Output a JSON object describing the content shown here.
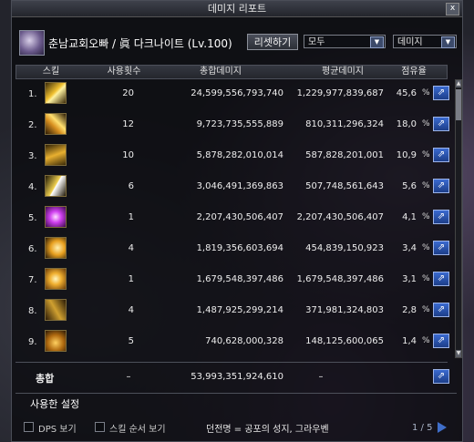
{
  "window": {
    "title": "데미지 리포트",
    "close_label": "x"
  },
  "header": {
    "character_name": "춘남교회오빠 / 眞 다크나이트 (Lv.100)",
    "reset_button": "리셋하기",
    "filter_select": "모두",
    "metric_select": "데미지"
  },
  "table": {
    "columns": [
      "스킬",
      "사용횟수",
      "총합데미지",
      "평균데미지",
      "점유율"
    ],
    "percent_symbol": "%",
    "rows": [
      {
        "rank": "1.",
        "uses": "20",
        "total": "24,599,556,793,740",
        "avg": "1,229,977,839,687",
        "share": "45,6"
      },
      {
        "rank": "2.",
        "uses": "12",
        "total": "9,723,735,555,889",
        "avg": "810,311,296,324",
        "share": "18,0"
      },
      {
        "rank": "3.",
        "uses": "10",
        "total": "5,878,282,010,014",
        "avg": "587,828,201,001",
        "share": "10,9"
      },
      {
        "rank": "4.",
        "uses": "6",
        "total": "3,046,491,369,863",
        "avg": "507,748,561,643",
        "share": "5,6"
      },
      {
        "rank": "5.",
        "uses": "1",
        "total": "2,207,430,506,407",
        "avg": "2,207,430,506,407",
        "share": "4,1"
      },
      {
        "rank": "6.",
        "uses": "4",
        "total": "1,819,356,603,694",
        "avg": "454,839,150,923",
        "share": "3,4"
      },
      {
        "rank": "7.",
        "uses": "1",
        "total": "1,679,548,397,486",
        "avg": "1,679,548,397,486",
        "share": "3,1"
      },
      {
        "rank": "8.",
        "uses": "4",
        "total": "1,487,925,299,214",
        "avg": "371,981,324,803",
        "share": "2,8"
      },
      {
        "rank": "9.",
        "uses": "5",
        "total": "740,628,000,328",
        "avg": "148,125,600,065",
        "share": "1,4"
      }
    ],
    "total": {
      "label": "총합",
      "uses": "–",
      "total": "53,993,351,924,610",
      "avg": "–"
    }
  },
  "tabs": {
    "active": "사용한 설정"
  },
  "footer": {
    "dps_label": "DPS 보기",
    "order_label": "스킬 순서 보기",
    "dungeon": "던전명 = 공포의 성지, 그라우벤",
    "page": "1 / 5"
  },
  "colors": {
    "accent_blue": "#2f5fc4",
    "icon_gold": "#e0b020",
    "icon_purple": "#c040e0"
  }
}
